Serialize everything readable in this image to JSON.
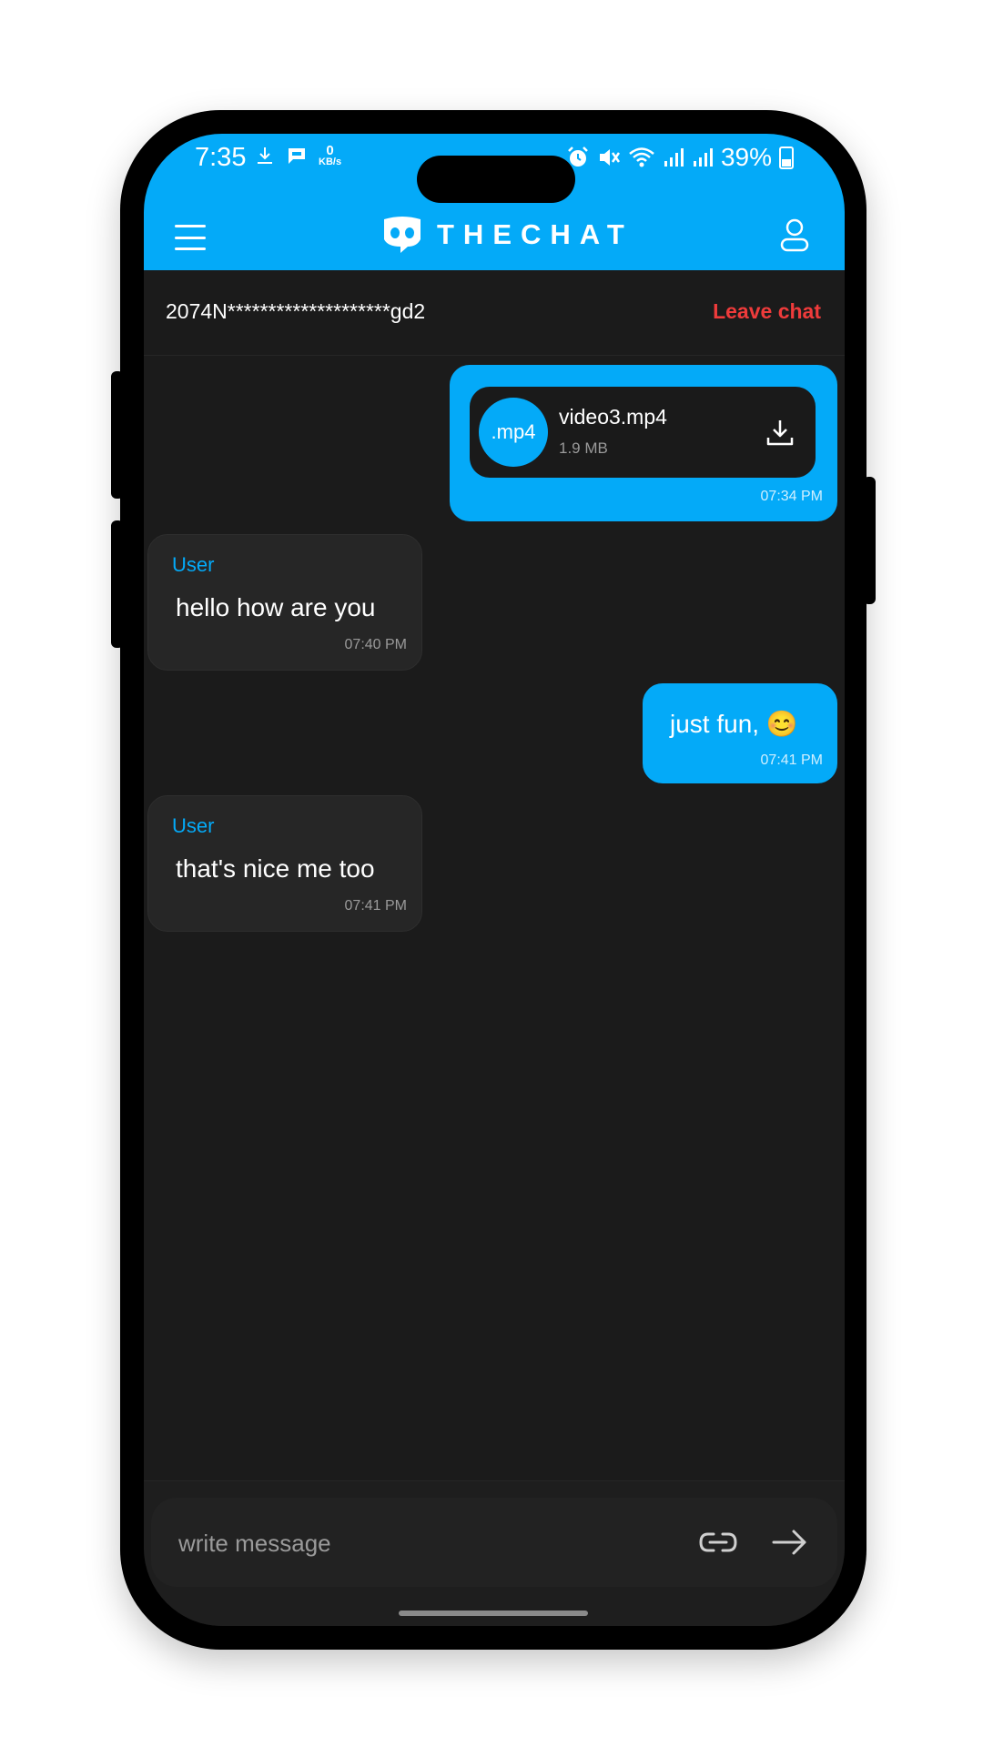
{
  "status_bar": {
    "time": "7:35",
    "net_speed_value": "0",
    "net_speed_unit": "KB/s",
    "battery": "39%"
  },
  "app": {
    "title": "THECHAT"
  },
  "chat_bar": {
    "chat_id": "2074N********************gd2",
    "leave_label": "Leave chat"
  },
  "messages": [
    {
      "type": "file",
      "direction": "outgoing",
      "file_badge": ".mp4",
      "file_name": "video3.mp4",
      "file_size": "1.9 MB",
      "time": "07:34 PM"
    },
    {
      "type": "text",
      "direction": "incoming",
      "sender": "User",
      "text": "hello how are you",
      "time": "07:40 PM"
    },
    {
      "type": "text",
      "direction": "outgoing",
      "text": "just fun, 😊",
      "time": "07:41 PM"
    },
    {
      "type": "text",
      "direction": "incoming",
      "sender": "User",
      "text": "that's nice me too",
      "time": "07:41 PM"
    }
  ],
  "composer": {
    "placeholder": "write message"
  },
  "colors": {
    "accent": "#04aaf8",
    "background": "#1b1b1b",
    "incoming_bubble": "#262626",
    "danger": "#ef3b3b"
  },
  "icons": {
    "menu": "hamburger-menu-icon",
    "logo": "chat-mascot-logo",
    "profile": "user-profile-icon",
    "download": "download-icon",
    "attach": "link-icon",
    "send": "arrow-right-send-icon"
  }
}
